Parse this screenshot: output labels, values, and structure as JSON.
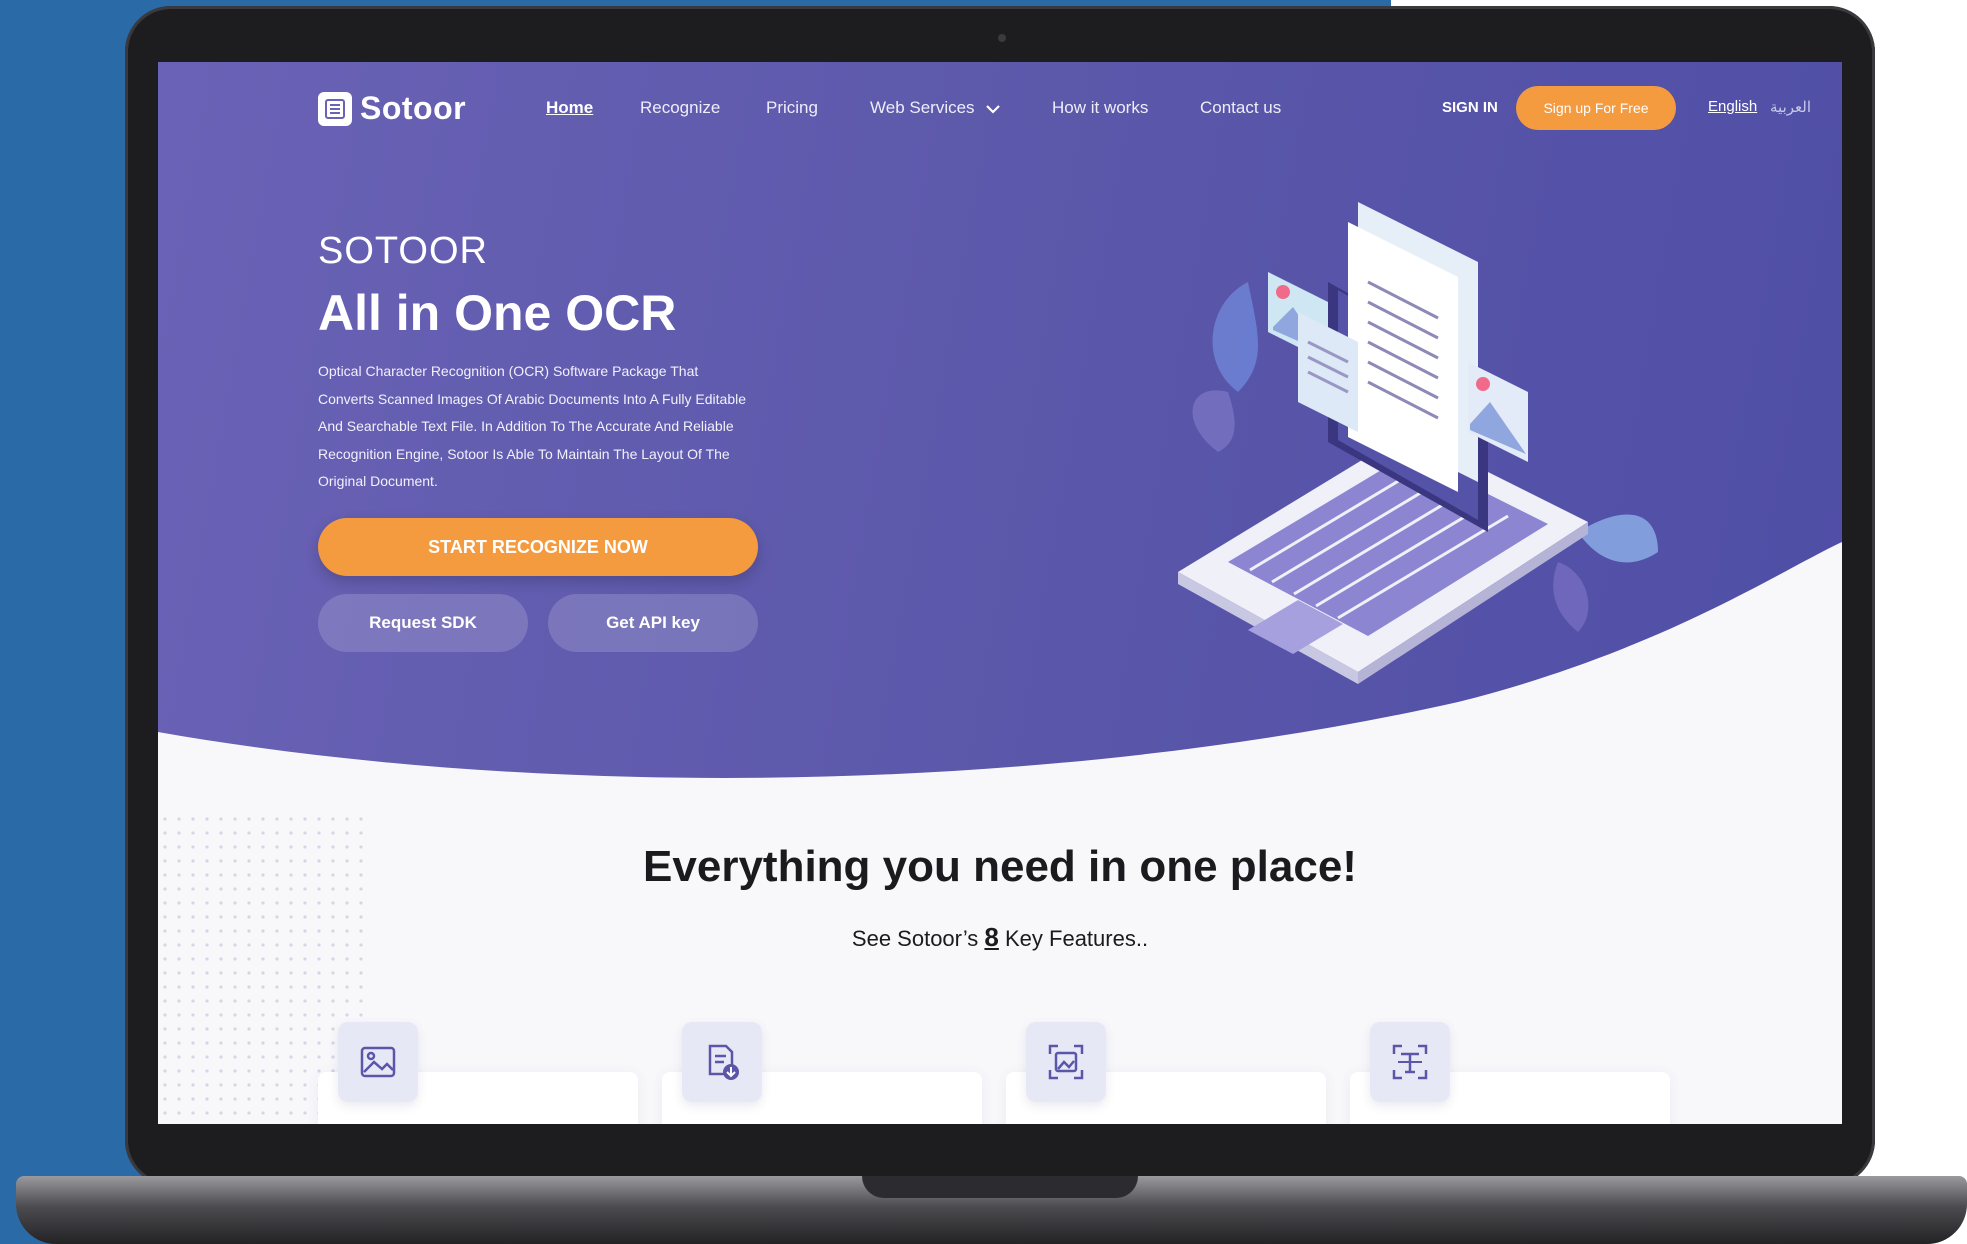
{
  "nav": {
    "logo_text": "Sotoor",
    "links": [
      "Home",
      "Recognize",
      "Pricing",
      "Web Services",
      "How it works",
      "Contact us"
    ],
    "sign_in": "SIGN IN",
    "sign_up": "Sign up For Free",
    "lang_english": "English",
    "lang_arabic": "العربية"
  },
  "hero": {
    "brand": "SOTOOR",
    "headline": "All in One OCR",
    "description": "Optical Character Recognition (OCR) Software Package That Converts Scanned Images Of Arabic Documents Into A Fully Editable And Searchable Text File. In Addition To The Accurate And Reliable Recognition Engine, Sotoor Is Able To Maintain The Layout Of The Original Document.",
    "cta": "START RECOGNIZE NOW",
    "request_sdk": "Request SDK",
    "get_api_key": "Get API key"
  },
  "features": {
    "title": "Everything you need in one place!",
    "subtitle_pre": "See Sotoor’s ",
    "subtitle_num": "8",
    "subtitle_post": " Key Features..",
    "icons": [
      "image-icon",
      "document-download-icon",
      "image-scan-icon",
      "text-scan-icon"
    ]
  },
  "colors": {
    "hero": "#5d59ab",
    "accent": "#f49a3f",
    "outer_background": "#2a6aa6"
  }
}
